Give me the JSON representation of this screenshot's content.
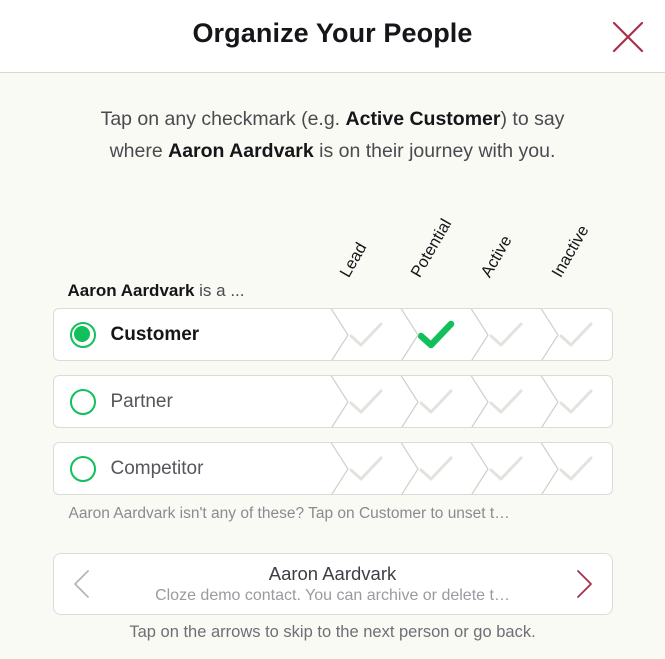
{
  "header": {
    "title": "Organize Your People",
    "close_icon": "close-x-icon",
    "close_color": "#A9304C"
  },
  "intro": {
    "line1_before": "Tap on any checkmark (e.g. ",
    "line1_bold": "Active Customer",
    "line1_after": ") to say",
    "line2_before": "where ",
    "line2_bold": "Aaron Aardvark",
    "line2_after": " is on their journey with you."
  },
  "matrix": {
    "row_label_bold": "Aaron Aardvark",
    "row_label_rest": " is a ...",
    "columns": [
      "Lead",
      "Potential",
      "Active",
      "Inactive"
    ],
    "rows": [
      {
        "name": "Customer",
        "selected": true,
        "radio_icon": "radio-checked-icon",
        "stages": [
          "unset",
          "set",
          "unset",
          "unset"
        ]
      },
      {
        "name": "Partner",
        "selected": false,
        "radio_icon": "radio-unchecked-icon",
        "stages": [
          "unset",
          "unset",
          "unset",
          "unset"
        ]
      },
      {
        "name": "Competitor",
        "selected": false,
        "radio_icon": "radio-unchecked-icon",
        "stages": [
          "unset",
          "unset",
          "unset",
          "unset"
        ]
      }
    ],
    "hint": "Aaron Aardvark isn't any of these? Tap on Customer to unset t…"
  },
  "nav": {
    "prev_icon": "chevron-left-icon",
    "next_icon": "chevron-right-icon",
    "prev_enabled_color": "#B6B6B6",
    "next_enabled_color": "#A9304C",
    "title": "Aaron Aardvark",
    "subtitle": "Cloze demo contact. You can archive or delete t…",
    "footer_hint": "Tap on the arrows to skip to the next person or go back."
  },
  "colors": {
    "accent_green": "#12C05B",
    "crimson": "#A9304C",
    "page_background": "#FAFAF5",
    "card_background": "#FFFFFF"
  }
}
